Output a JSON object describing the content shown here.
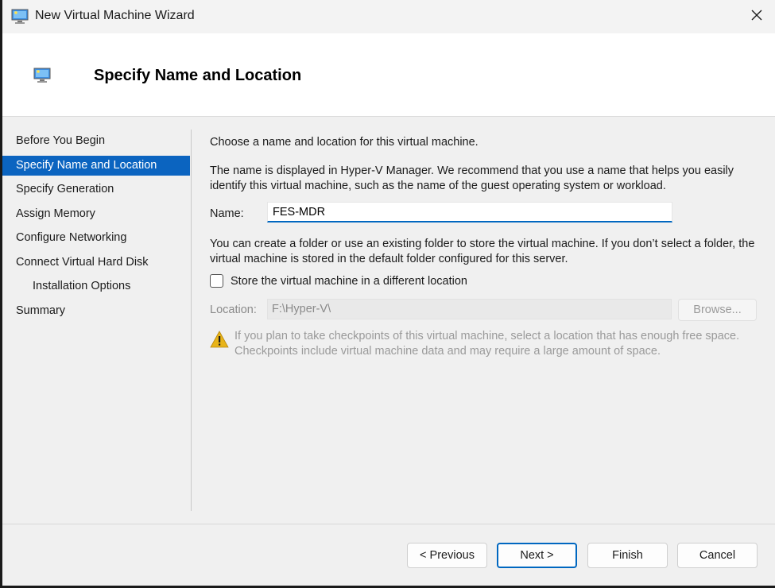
{
  "window": {
    "title": "New Virtual Machine Wizard"
  },
  "header": {
    "title": "Specify Name and Location"
  },
  "steps": [
    {
      "label": "Before You Begin"
    },
    {
      "label": "Specify Name and Location"
    },
    {
      "label": "Specify Generation"
    },
    {
      "label": "Assign Memory"
    },
    {
      "label": "Configure Networking"
    },
    {
      "label": "Connect Virtual Hard Disk"
    },
    {
      "label": "Installation Options"
    },
    {
      "label": "Summary"
    }
  ],
  "content": {
    "intro": "Choose a name and location for this virtual machine.",
    "name_help": "The name is displayed in Hyper-V Manager. We recommend that you use a name that helps you easily identify this virtual machine, such as the name of the guest operating system or workload.",
    "name_label": "Name:",
    "name_value": "FES-MDR",
    "folder_help": "You can create a folder or use an existing folder to store the virtual machine. If you don’t select a folder, the virtual machine is stored in the default folder configured for this server.",
    "checkbox_label": "Store the virtual machine in a different location",
    "checkbox_checked": false,
    "location_label": "Location:",
    "location_value": "F:\\Hyper-V\\",
    "browse_label": "Browse...",
    "warning": "If you plan to take checkpoints of this virtual machine, select a location that has enough free space. Checkpoints include virtual machine data and may require a large amount of space."
  },
  "buttons": {
    "previous": "< Previous",
    "next": "Next >",
    "finish": "Finish",
    "cancel": "Cancel"
  },
  "icons": {
    "app": "vm-monitor-icon",
    "close": "close-icon",
    "warning": "warning-icon"
  },
  "colors": {
    "accent": "#0067c0",
    "selected_step": "#0b64c0",
    "warning": "#e8b419"
  }
}
